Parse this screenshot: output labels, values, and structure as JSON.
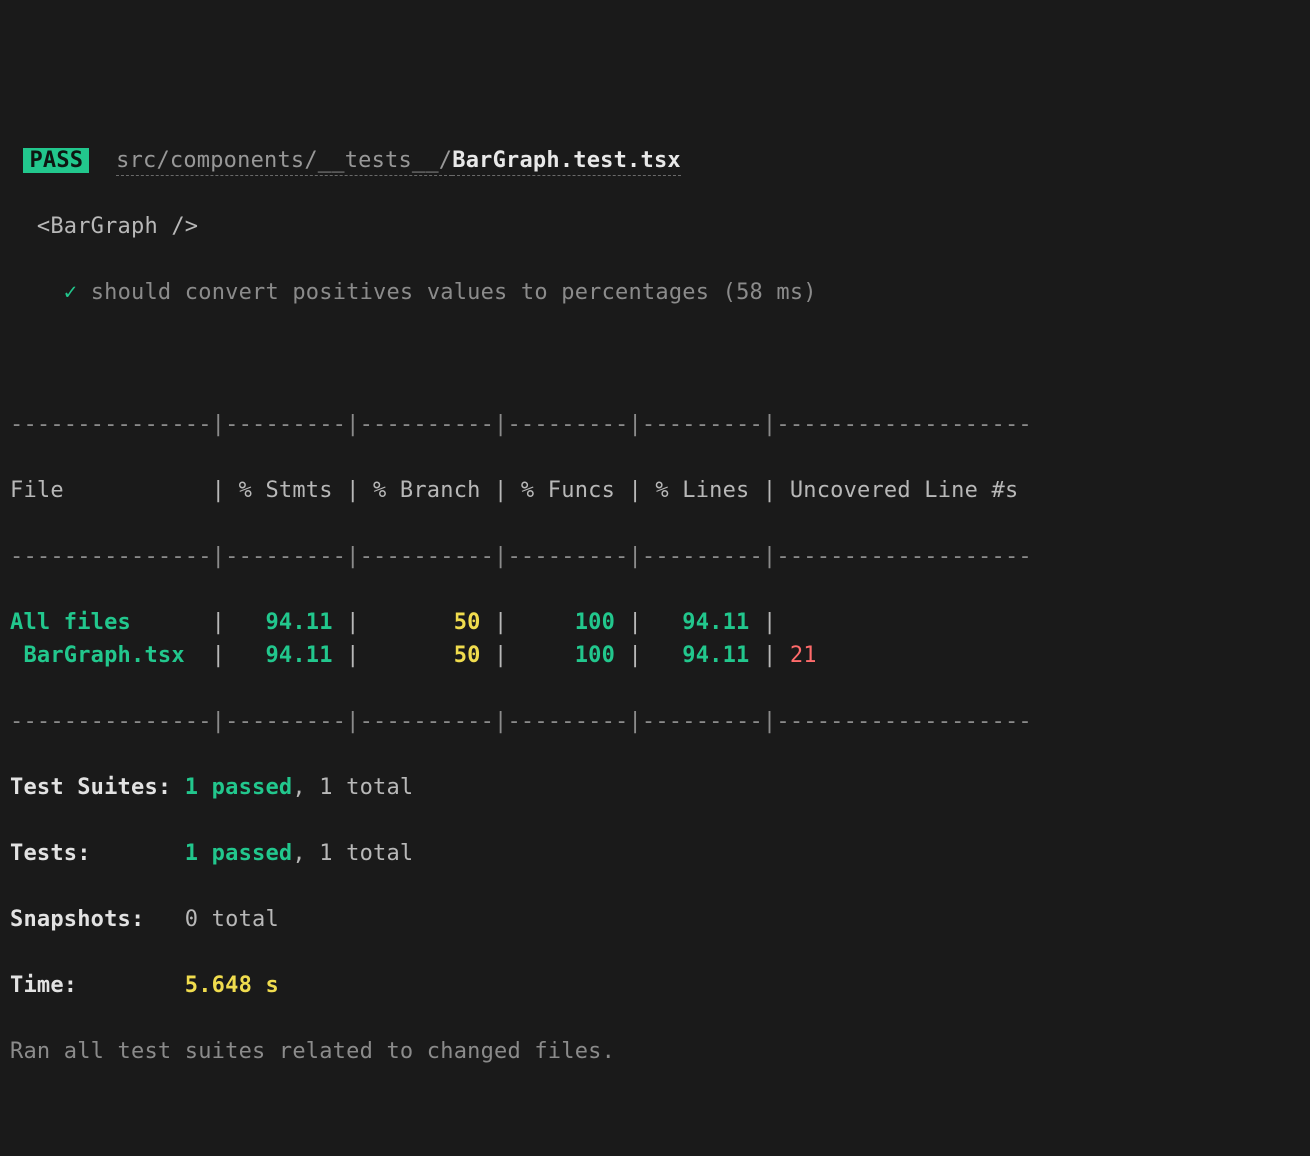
{
  "status": {
    "label": "PASS"
  },
  "path": {
    "dir": "src/components/__tests__/",
    "file": "BarGraph.test.tsx"
  },
  "suite": {
    "describe": "<BarGraph />",
    "test": "should convert positives values to percentages",
    "duration": "(58 ms)"
  },
  "table": {
    "border_top": "---------------|---------|----------|---------|---------|-------------------",
    "header": "File           | % Stmts | % Branch | % Funcs | % Lines | Uncovered Line #s ",
    "header_border": "---------------|---------|----------|---------|---------|-------------------",
    "rows": [
      {
        "file": "All files",
        "indent": "",
        "stmts": "94.11",
        "branch": "50",
        "funcs": "100",
        "lines": "94.11",
        "uncovered": ""
      },
      {
        "file": "BarGraph.tsx",
        "indent": " ",
        "stmts": "94.11",
        "branch": "50",
        "funcs": "100",
        "lines": "94.11",
        "uncovered": "21"
      }
    ],
    "border_bot": "---------------|---------|----------|---------|---------|-------------------"
  },
  "summary": {
    "test_suites": {
      "label": "Test Suites:",
      "passed": "1 passed",
      "rest": ", 1 total"
    },
    "tests": {
      "label": "Tests:",
      "passed": "1 passed",
      "rest": ", 1 total"
    },
    "snapshots": {
      "label": "Snapshots:",
      "rest": "0 total"
    },
    "time": {
      "label": "Time:",
      "value": "5.648 s"
    },
    "footer": "Ran all test suites related to changed files."
  }
}
